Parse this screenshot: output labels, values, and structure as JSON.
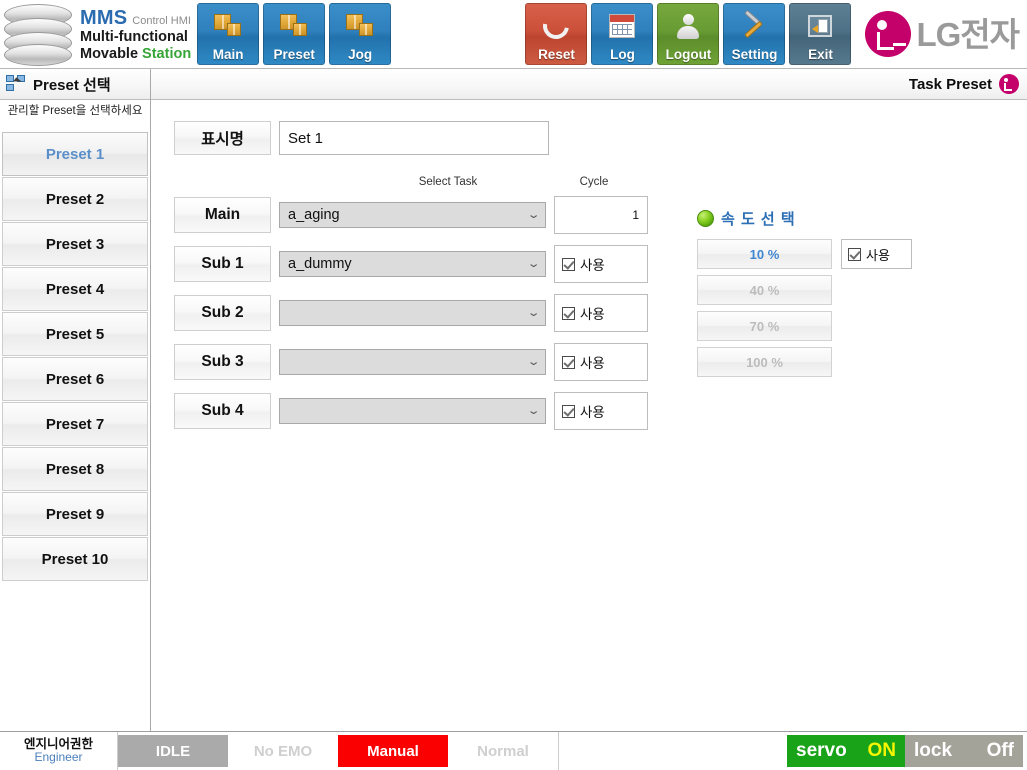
{
  "brand": {
    "mms": "MMS",
    "control_hmi": "Control HMI",
    "line2": "Multi-functional",
    "line3_a": "Movable ",
    "line3_b": "Station",
    "db_icon": "database-stack-icon"
  },
  "nav": [
    {
      "label": "Main",
      "icon": "boxes-icon",
      "style": "bl"
    },
    {
      "label": "Preset",
      "icon": "boxes-icon",
      "style": "bl"
    },
    {
      "label": "Jog",
      "icon": "boxes-icon",
      "style": "bl"
    }
  ],
  "actions": [
    {
      "label": "Reset",
      "icon": "refresh-icon",
      "style": "red"
    },
    {
      "label": "Log",
      "icon": "calendar-icon",
      "style": "bl"
    },
    {
      "label": "Logout",
      "icon": "user-icon",
      "style": "green"
    },
    {
      "label": "Setting",
      "icon": "tools-icon",
      "style": "bl"
    },
    {
      "label": "Exit",
      "icon": "exit-icon",
      "style": "slate"
    }
  ],
  "lg": {
    "word": "LG전자",
    "logo_icon": "lg-logo-icon"
  },
  "sidebar": {
    "title": "Preset 선택",
    "title_icon": "select-window-icon",
    "note": "관리할 Preset을 선택하세요",
    "items": [
      {
        "label": "Preset 1",
        "selected": true
      },
      {
        "label": "Preset 2",
        "selected": false
      },
      {
        "label": "Preset 3",
        "selected": false
      },
      {
        "label": "Preset 4",
        "selected": false
      },
      {
        "label": "Preset 5",
        "selected": false
      },
      {
        "label": "Preset 6",
        "selected": false
      },
      {
        "label": "Preset 7",
        "selected": false
      },
      {
        "label": "Preset 8",
        "selected": false
      },
      {
        "label": "Preset 9",
        "selected": false
      },
      {
        "label": "Preset 10",
        "selected": false
      }
    ]
  },
  "main": {
    "title": "Task Preset",
    "title_icon": "lg-logo-icon",
    "display_name": {
      "label": "표시명",
      "value": "Set 1",
      "placeholder": ""
    },
    "columns": {
      "select_task": "Select Task",
      "cycle": "Cycle"
    },
    "rows": [
      {
        "label": "Main",
        "task": "a_aging",
        "cycle_value": "1",
        "right_type": "cycle"
      },
      {
        "label": "Sub 1",
        "task": "a_dummy",
        "use_label": "사용",
        "use_checked": true,
        "right_type": "use"
      },
      {
        "label": "Sub 2",
        "task": "",
        "use_label": "사용",
        "use_checked": true,
        "right_type": "use"
      },
      {
        "label": "Sub 3",
        "task": "",
        "use_label": "사용",
        "use_checked": true,
        "right_type": "use"
      },
      {
        "label": "Sub 4",
        "task": "",
        "use_label": "사용",
        "use_checked": true,
        "right_type": "use"
      }
    ],
    "speed": {
      "title": "속 도 선 택",
      "title_icon": "green-globe-icon",
      "options": [
        {
          "label": "10 %",
          "active": true
        },
        {
          "label": "40 %",
          "active": false
        },
        {
          "label": "70 %",
          "active": false
        },
        {
          "label": "100 %",
          "active": false
        }
      ],
      "use_label": "사용",
      "use_checked": true
    }
  },
  "status": {
    "auth_ko": "엔지니어권한",
    "auth_en": "Engineer",
    "segments": [
      {
        "label": "IDLE",
        "state": "gray"
      },
      {
        "label": "No EMO",
        "state": "pale"
      },
      {
        "label": "Manual",
        "state": "danger"
      },
      {
        "label": "Normal",
        "state": "pale"
      }
    ],
    "servo": {
      "name": "servo",
      "value": "ON"
    },
    "lock": {
      "name": "lock",
      "value": "Off"
    }
  },
  "colors": {
    "accent_blue": "#2b6bb0",
    "station_green": "#36a536",
    "lg_magenta": "#c4006a",
    "danger_red": "#fb0000",
    "servo_green": "#18a318",
    "servo_on_yellow": "#f5f500",
    "selected_text": "#5b8fc9"
  }
}
